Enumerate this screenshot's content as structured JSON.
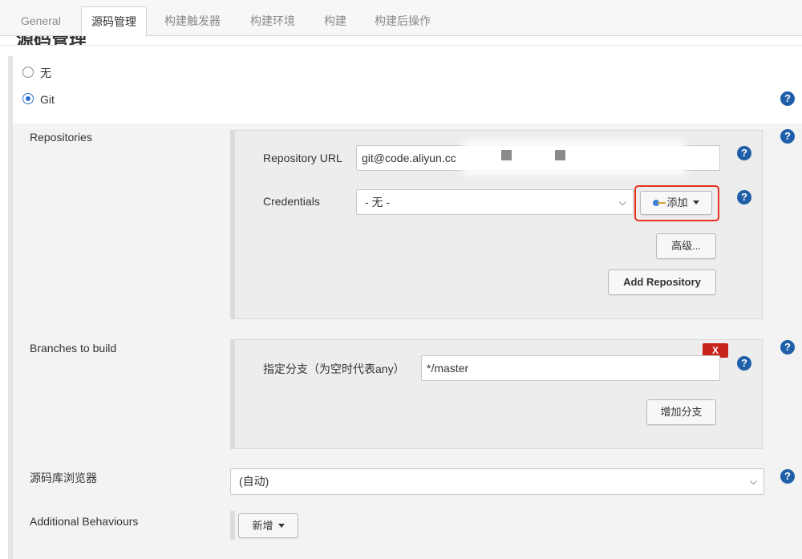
{
  "tabs": [
    {
      "label": "General",
      "active": false
    },
    {
      "label": "源码管理",
      "active": true
    },
    {
      "label": "构建触发器",
      "active": false
    },
    {
      "label": "构建环境",
      "active": false
    },
    {
      "label": "构建",
      "active": false
    },
    {
      "label": "构建后操作",
      "active": false
    }
  ],
  "section_title": "源码管理",
  "scm_options": [
    {
      "label": "无",
      "checked": false
    },
    {
      "label": "Git",
      "checked": true
    }
  ],
  "help_glyph": "?",
  "repositories": {
    "label": "Repositories",
    "url_label": "Repository URL",
    "url_value": "git@code.aliyun.cc",
    "credentials_label": "Credentials",
    "credentials_value": "- 无 -",
    "add_label": "添加",
    "advanced_label": "高级...",
    "add_repository_label": "Add Repository"
  },
  "branches": {
    "label": "Branches to build",
    "specifier_label": "指定分支（为空时代表any）",
    "specifier_value": "*/master",
    "delete_label": "X",
    "add_branch_label": "增加分支"
  },
  "browser": {
    "label": "源码库浏览器",
    "value": "(自动)"
  },
  "behaviours": {
    "label": "Additional Behaviours",
    "add_label": "新增"
  },
  "colors": {
    "accent": "#2c6fd1",
    "help": "#1f5fa8",
    "highlight": "#e8301e",
    "delete": "#c9241b"
  }
}
